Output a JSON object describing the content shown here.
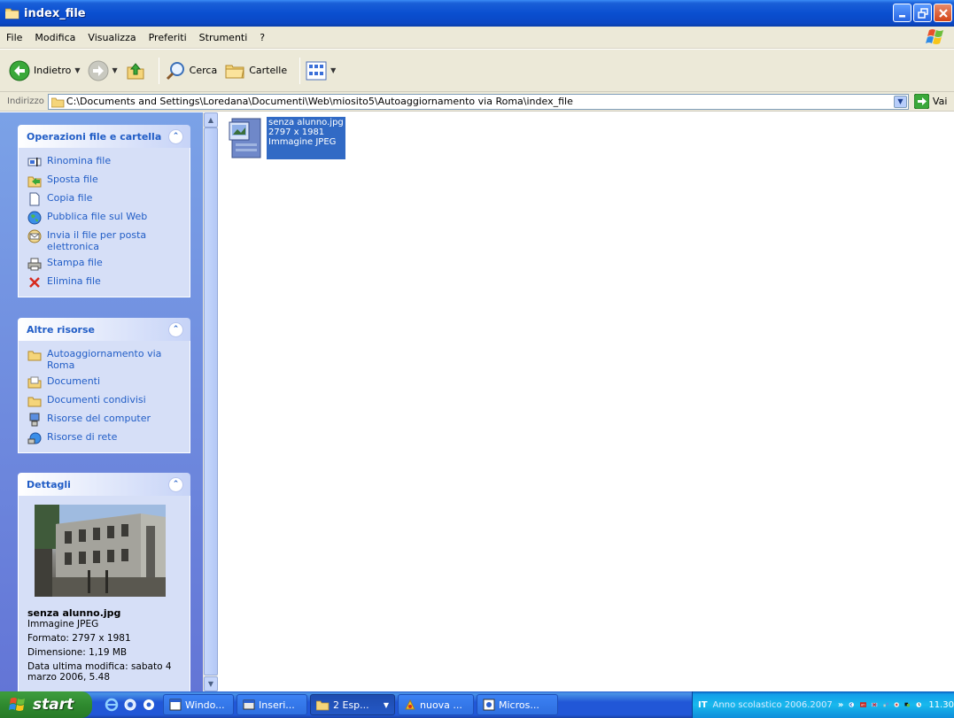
{
  "window": {
    "title": "index_file"
  },
  "menu": {
    "items": [
      "File",
      "Modifica",
      "Visualizza",
      "Preferiti",
      "Strumenti",
      "?"
    ]
  },
  "toolbar": {
    "back_label": "Indietro",
    "search_label": "Cerca",
    "folders_label": "Cartelle"
  },
  "address": {
    "label": "Indirizzo",
    "path": "C:\\Documents and Settings\\Loredana\\Documenti\\Web\\miosito5\\Autoaggiornamento via Roma\\index_file",
    "go_label": "Vai"
  },
  "panels": {
    "file_tasks": {
      "title": "Operazioni file e cartella",
      "items": [
        "Rinomina file",
        "Sposta file",
        "Copia file",
        "Pubblica file sul Web",
        "Invia il file per posta elettronica",
        "Stampa file",
        "Elimina file"
      ]
    },
    "other_places": {
      "title": "Altre risorse",
      "items": [
        "Autoaggiornamento via Roma",
        "Documenti",
        "Documenti condivisi",
        "Risorse del computer",
        "Risorse di rete"
      ]
    },
    "details": {
      "title": "Dettagli",
      "name": "senza alunno.jpg",
      "type": "Immagine JPEG",
      "format": "Formato: 2797 x 1981",
      "size": "Dimensione: 1,19 MB",
      "modified": "Data ultima modifica: sabato 4 marzo 2006, 5.48"
    }
  },
  "file": {
    "name": "senza alunno.jpg",
    "dims": "2797 x 1981",
    "type": "Immagine JPEG"
  },
  "taskbar": {
    "start_label": "start",
    "buttons": [
      "Windo...",
      "Inseri...",
      "2 Esp...",
      "nuova ...",
      "Micros..."
    ],
    "lang": "IT",
    "tray_text": "Anno scolastico 2006.2007",
    "clock": "11.30"
  },
  "colors": {
    "titlebar": "#0a4fd0",
    "taskpane": "#6f8fdf",
    "selection": "#316ac5",
    "link": "#215dc6"
  }
}
